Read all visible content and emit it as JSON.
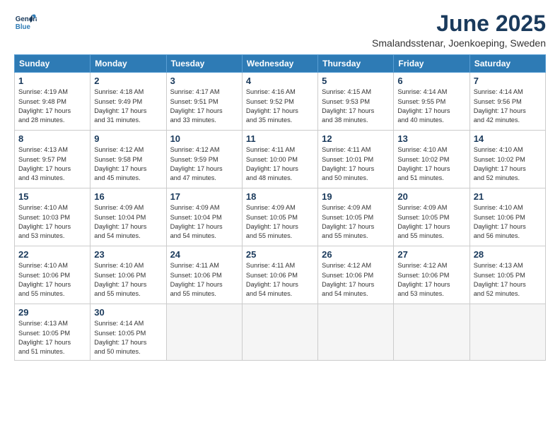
{
  "logo": {
    "line1": "General",
    "line2": "Blue"
  },
  "title": "June 2025",
  "subtitle": "Smalandsstenar, Joenkoeping, Sweden",
  "header_days": [
    "Sunday",
    "Monday",
    "Tuesday",
    "Wednesday",
    "Thursday",
    "Friday",
    "Saturday"
  ],
  "weeks": [
    [
      {
        "num": "1",
        "info": "Sunrise: 4:19 AM\nSunset: 9:48 PM\nDaylight: 17 hours\nand 28 minutes."
      },
      {
        "num": "2",
        "info": "Sunrise: 4:18 AM\nSunset: 9:49 PM\nDaylight: 17 hours\nand 31 minutes."
      },
      {
        "num": "3",
        "info": "Sunrise: 4:17 AM\nSunset: 9:51 PM\nDaylight: 17 hours\nand 33 minutes."
      },
      {
        "num": "4",
        "info": "Sunrise: 4:16 AM\nSunset: 9:52 PM\nDaylight: 17 hours\nand 35 minutes."
      },
      {
        "num": "5",
        "info": "Sunrise: 4:15 AM\nSunset: 9:53 PM\nDaylight: 17 hours\nand 38 minutes."
      },
      {
        "num": "6",
        "info": "Sunrise: 4:14 AM\nSunset: 9:55 PM\nDaylight: 17 hours\nand 40 minutes."
      },
      {
        "num": "7",
        "info": "Sunrise: 4:14 AM\nSunset: 9:56 PM\nDaylight: 17 hours\nand 42 minutes."
      }
    ],
    [
      {
        "num": "8",
        "info": "Sunrise: 4:13 AM\nSunset: 9:57 PM\nDaylight: 17 hours\nand 43 minutes."
      },
      {
        "num": "9",
        "info": "Sunrise: 4:12 AM\nSunset: 9:58 PM\nDaylight: 17 hours\nand 45 minutes."
      },
      {
        "num": "10",
        "info": "Sunrise: 4:12 AM\nSunset: 9:59 PM\nDaylight: 17 hours\nand 47 minutes."
      },
      {
        "num": "11",
        "info": "Sunrise: 4:11 AM\nSunset: 10:00 PM\nDaylight: 17 hours\nand 48 minutes."
      },
      {
        "num": "12",
        "info": "Sunrise: 4:11 AM\nSunset: 10:01 PM\nDaylight: 17 hours\nand 50 minutes."
      },
      {
        "num": "13",
        "info": "Sunrise: 4:10 AM\nSunset: 10:02 PM\nDaylight: 17 hours\nand 51 minutes."
      },
      {
        "num": "14",
        "info": "Sunrise: 4:10 AM\nSunset: 10:02 PM\nDaylight: 17 hours\nand 52 minutes."
      }
    ],
    [
      {
        "num": "15",
        "info": "Sunrise: 4:10 AM\nSunset: 10:03 PM\nDaylight: 17 hours\nand 53 minutes."
      },
      {
        "num": "16",
        "info": "Sunrise: 4:09 AM\nSunset: 10:04 PM\nDaylight: 17 hours\nand 54 minutes."
      },
      {
        "num": "17",
        "info": "Sunrise: 4:09 AM\nSunset: 10:04 PM\nDaylight: 17 hours\nand 54 minutes."
      },
      {
        "num": "18",
        "info": "Sunrise: 4:09 AM\nSunset: 10:05 PM\nDaylight: 17 hours\nand 55 minutes."
      },
      {
        "num": "19",
        "info": "Sunrise: 4:09 AM\nSunset: 10:05 PM\nDaylight: 17 hours\nand 55 minutes."
      },
      {
        "num": "20",
        "info": "Sunrise: 4:09 AM\nSunset: 10:05 PM\nDaylight: 17 hours\nand 55 minutes."
      },
      {
        "num": "21",
        "info": "Sunrise: 4:10 AM\nSunset: 10:06 PM\nDaylight: 17 hours\nand 56 minutes."
      }
    ],
    [
      {
        "num": "22",
        "info": "Sunrise: 4:10 AM\nSunset: 10:06 PM\nDaylight: 17 hours\nand 55 minutes."
      },
      {
        "num": "23",
        "info": "Sunrise: 4:10 AM\nSunset: 10:06 PM\nDaylight: 17 hours\nand 55 minutes."
      },
      {
        "num": "24",
        "info": "Sunrise: 4:11 AM\nSunset: 10:06 PM\nDaylight: 17 hours\nand 55 minutes."
      },
      {
        "num": "25",
        "info": "Sunrise: 4:11 AM\nSunset: 10:06 PM\nDaylight: 17 hours\nand 54 minutes."
      },
      {
        "num": "26",
        "info": "Sunrise: 4:12 AM\nSunset: 10:06 PM\nDaylight: 17 hours\nand 54 minutes."
      },
      {
        "num": "27",
        "info": "Sunrise: 4:12 AM\nSunset: 10:06 PM\nDaylight: 17 hours\nand 53 minutes."
      },
      {
        "num": "28",
        "info": "Sunrise: 4:13 AM\nSunset: 10:05 PM\nDaylight: 17 hours\nand 52 minutes."
      }
    ],
    [
      {
        "num": "29",
        "info": "Sunrise: 4:13 AM\nSunset: 10:05 PM\nDaylight: 17 hours\nand 51 minutes."
      },
      {
        "num": "30",
        "info": "Sunrise: 4:14 AM\nSunset: 10:05 PM\nDaylight: 17 hours\nand 50 minutes."
      },
      {
        "num": "",
        "info": ""
      },
      {
        "num": "",
        "info": ""
      },
      {
        "num": "",
        "info": ""
      },
      {
        "num": "",
        "info": ""
      },
      {
        "num": "",
        "info": ""
      }
    ]
  ]
}
